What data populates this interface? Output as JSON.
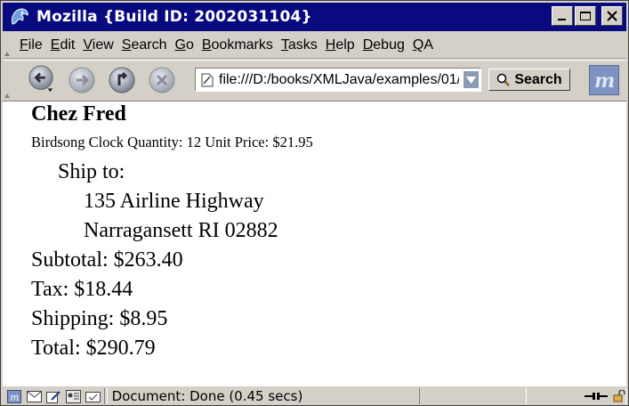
{
  "window": {
    "title": "Mozilla {Build ID: 2002031104}"
  },
  "menubar": {
    "items": [
      "File",
      "Edit",
      "View",
      "Search",
      "Go",
      "Bookmarks",
      "Tasks",
      "Help",
      "Debug",
      "QA"
    ]
  },
  "navbar": {
    "url": "file:///D:/books/XMLJava/examples/01/",
    "search_label": "Search",
    "buttons": [
      "back-icon",
      "forward-icon",
      "reload-icon",
      "stop-icon"
    ]
  },
  "document": {
    "shop_name": "Chez Fred",
    "item_line": "Birdsong Clock Quantity: 12 Unit Price: $21.95",
    "ship_to": "Ship to:",
    "address_line1": "135 Airline Highway",
    "address_line2": "Narragansett RI 02882",
    "subtotal": "Subtotal: $263.40",
    "tax": "Tax: $18.44",
    "shipping": "Shipping: $8.95",
    "total": "Total: $290.79"
  },
  "statusbar": {
    "text": "Document: Done (0.45 secs)",
    "icons": [
      "mozilla-icon",
      "mail-icon",
      "composer-icon",
      "addressbook-icon",
      "chat-icon"
    ]
  },
  "colors": {
    "titlebar": "#0a0a80",
    "chrome": "#d4d0c8",
    "content_bg": "#ffffff"
  }
}
